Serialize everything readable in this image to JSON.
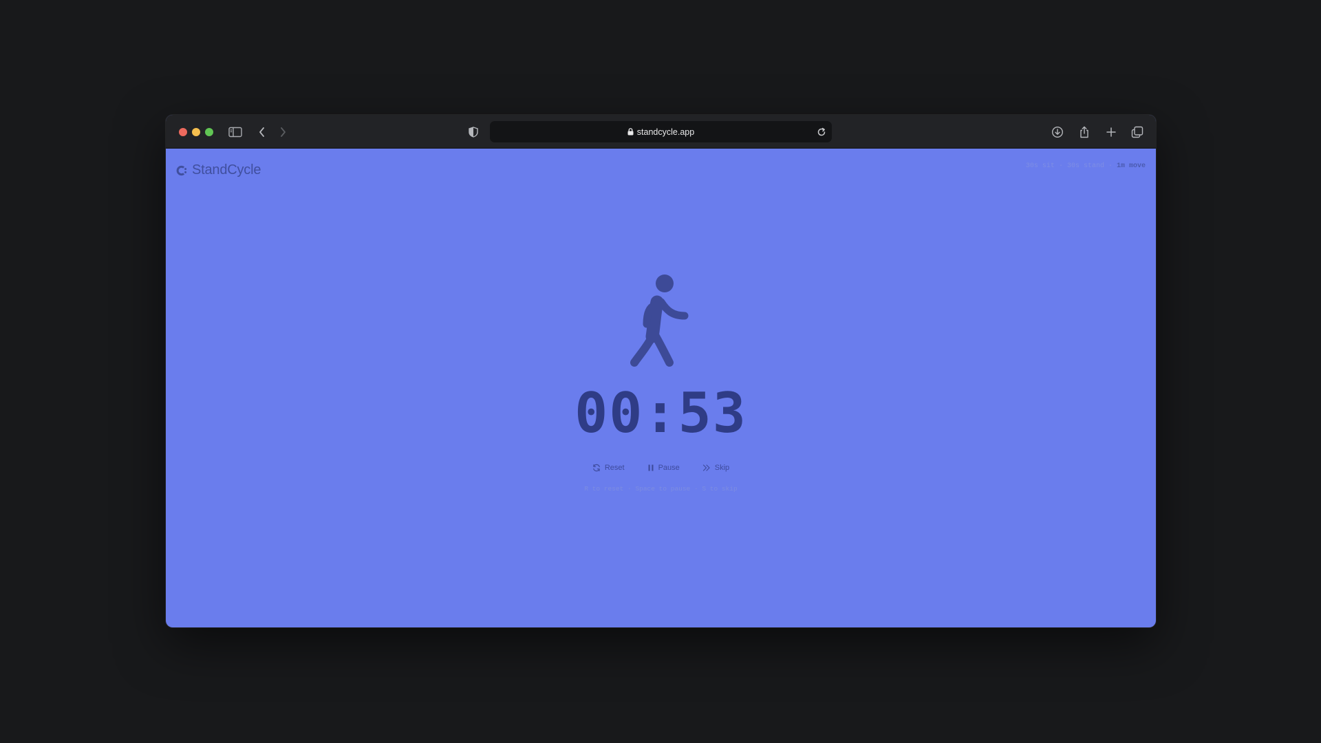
{
  "browser": {
    "url": "standcycle.app"
  },
  "app": {
    "brand": "StandCycle",
    "status": {
      "sit": "30s sit",
      "stand": "30s stand",
      "move": "1m move",
      "sep": "·"
    },
    "timer": "00:53",
    "controls": {
      "reset": "Reset",
      "pause": "Pause",
      "skip": "Skip"
    },
    "hints": "R to reset · Space to pause · S to skip"
  },
  "colors": {
    "background": "#6a7ded",
    "figure": "#3d4a97",
    "timer": "#2f3c86"
  }
}
